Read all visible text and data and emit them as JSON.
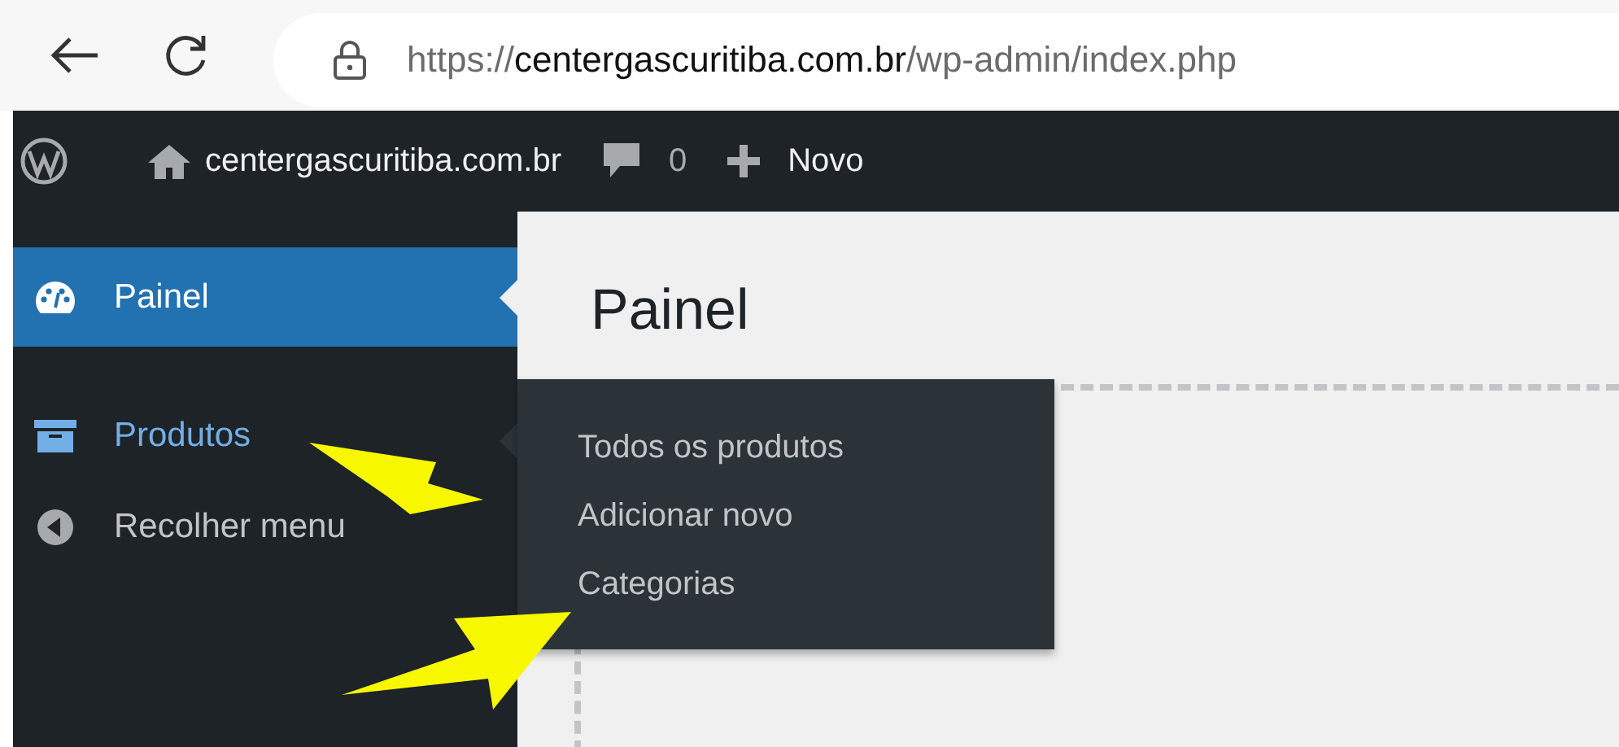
{
  "browser": {
    "url": {
      "scheme": "https://",
      "host": "centergascuritiba.com.br",
      "path": "/wp-admin/index.php"
    }
  },
  "admin_bar": {
    "site_name": "centergascuritiba.com.br",
    "comments_count": "0",
    "new_label": "Novo"
  },
  "sidebar": {
    "items": [
      {
        "label": "Painel",
        "kind": "dashboard",
        "selected": true,
        "hovered": false
      },
      {
        "label": "Produtos",
        "kind": "products",
        "selected": false,
        "hovered": true,
        "submenu": [
          {
            "label": "Todos os produtos"
          },
          {
            "label": "Adicionar novo"
          },
          {
            "label": "Categorias"
          }
        ]
      },
      {
        "label": "Recolher menu",
        "kind": "collapse",
        "selected": false,
        "hovered": false
      }
    ]
  },
  "page": {
    "title": "Painel"
  }
}
